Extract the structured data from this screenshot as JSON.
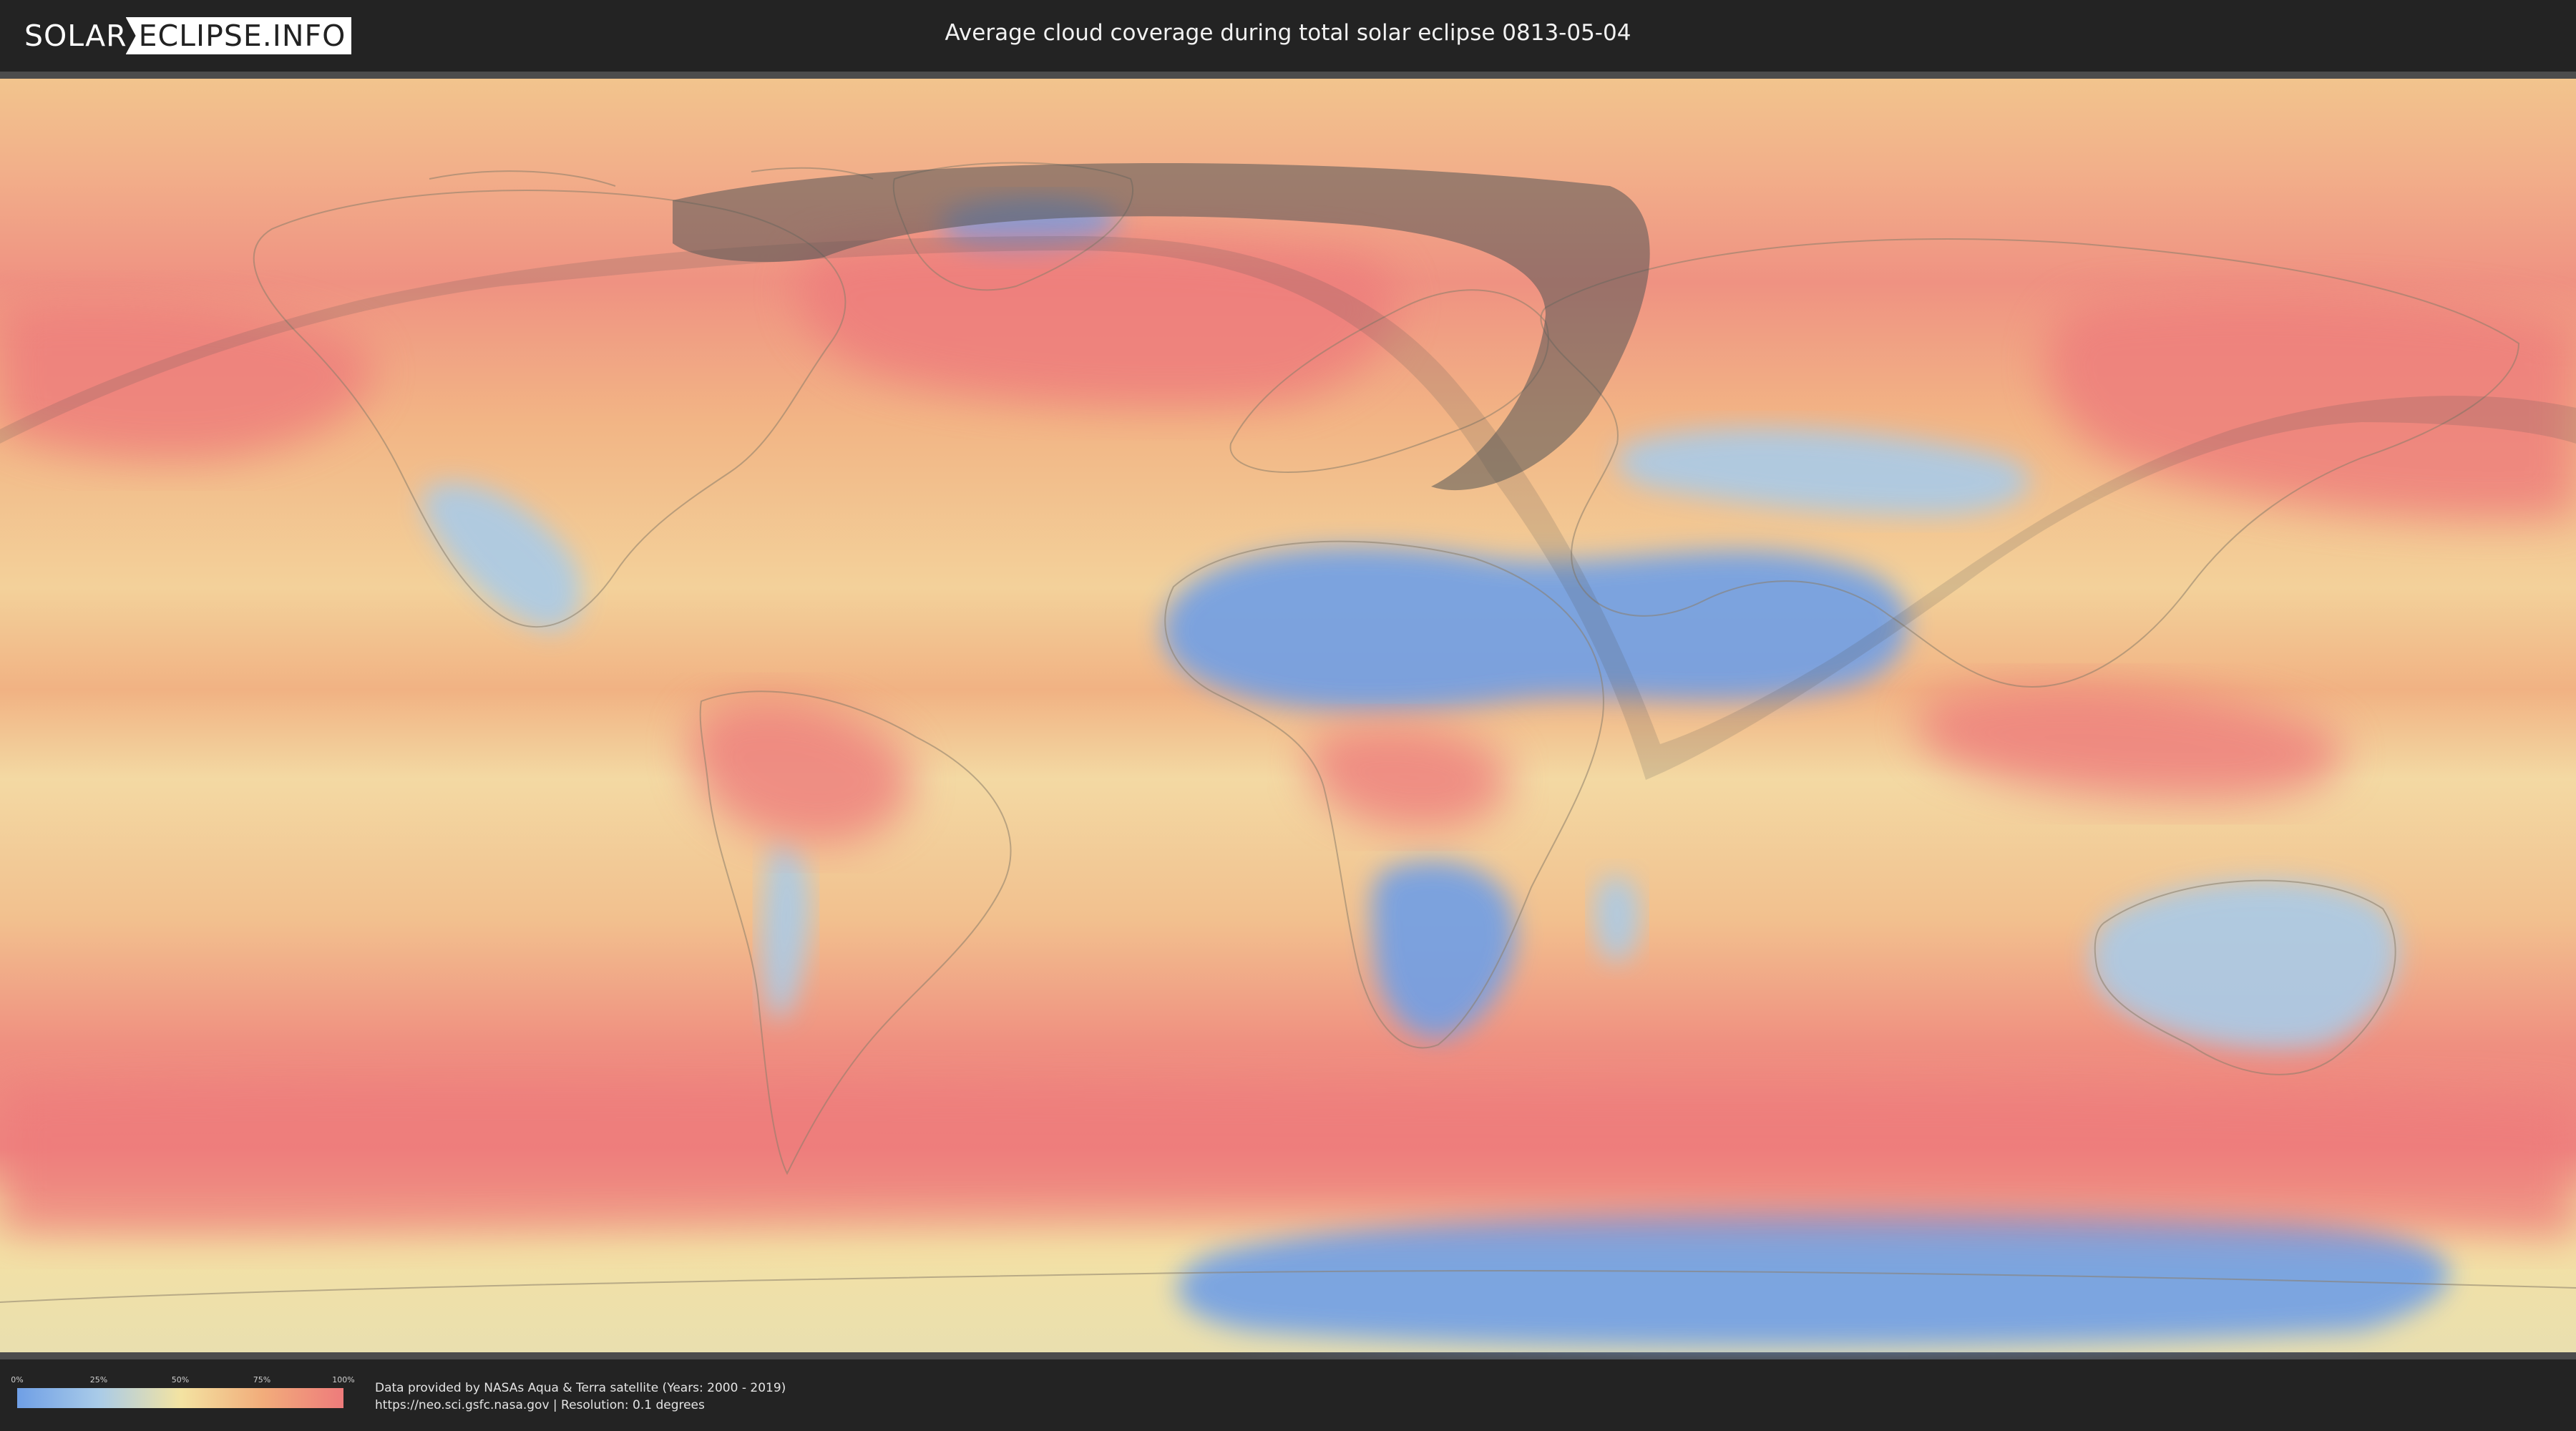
{
  "header": {
    "logo_left": "SOLAR",
    "logo_right": "ECLIPSE.INFO",
    "title": "Average cloud coverage during total solar eclipse 0813-05-04"
  },
  "map": {
    "layer": "average cloud coverage",
    "colors": {
      "clear": "#6f9fe6",
      "low": "#a9cbe8",
      "mid": "#f3e3a2",
      "high": "#f2ad7b",
      "overcast": "#ee7b7b",
      "eclipse_path": "#555555"
    }
  },
  "legend": {
    "ticks": [
      {
        "label": "0%",
        "value": 0
      },
      {
        "label": "25%",
        "value": 25
      },
      {
        "label": "50%",
        "value": 50
      },
      {
        "label": "75%",
        "value": 75
      },
      {
        "label": "100%",
        "value": 100
      }
    ]
  },
  "footer": {
    "source_line": "Data provided by NASAs Aqua & Terra satellite (Years: 2000 - 2019)",
    "url_line": "https://neo.sci.gsfc.nasa.gov | Resolution: 0.1 degrees"
  }
}
